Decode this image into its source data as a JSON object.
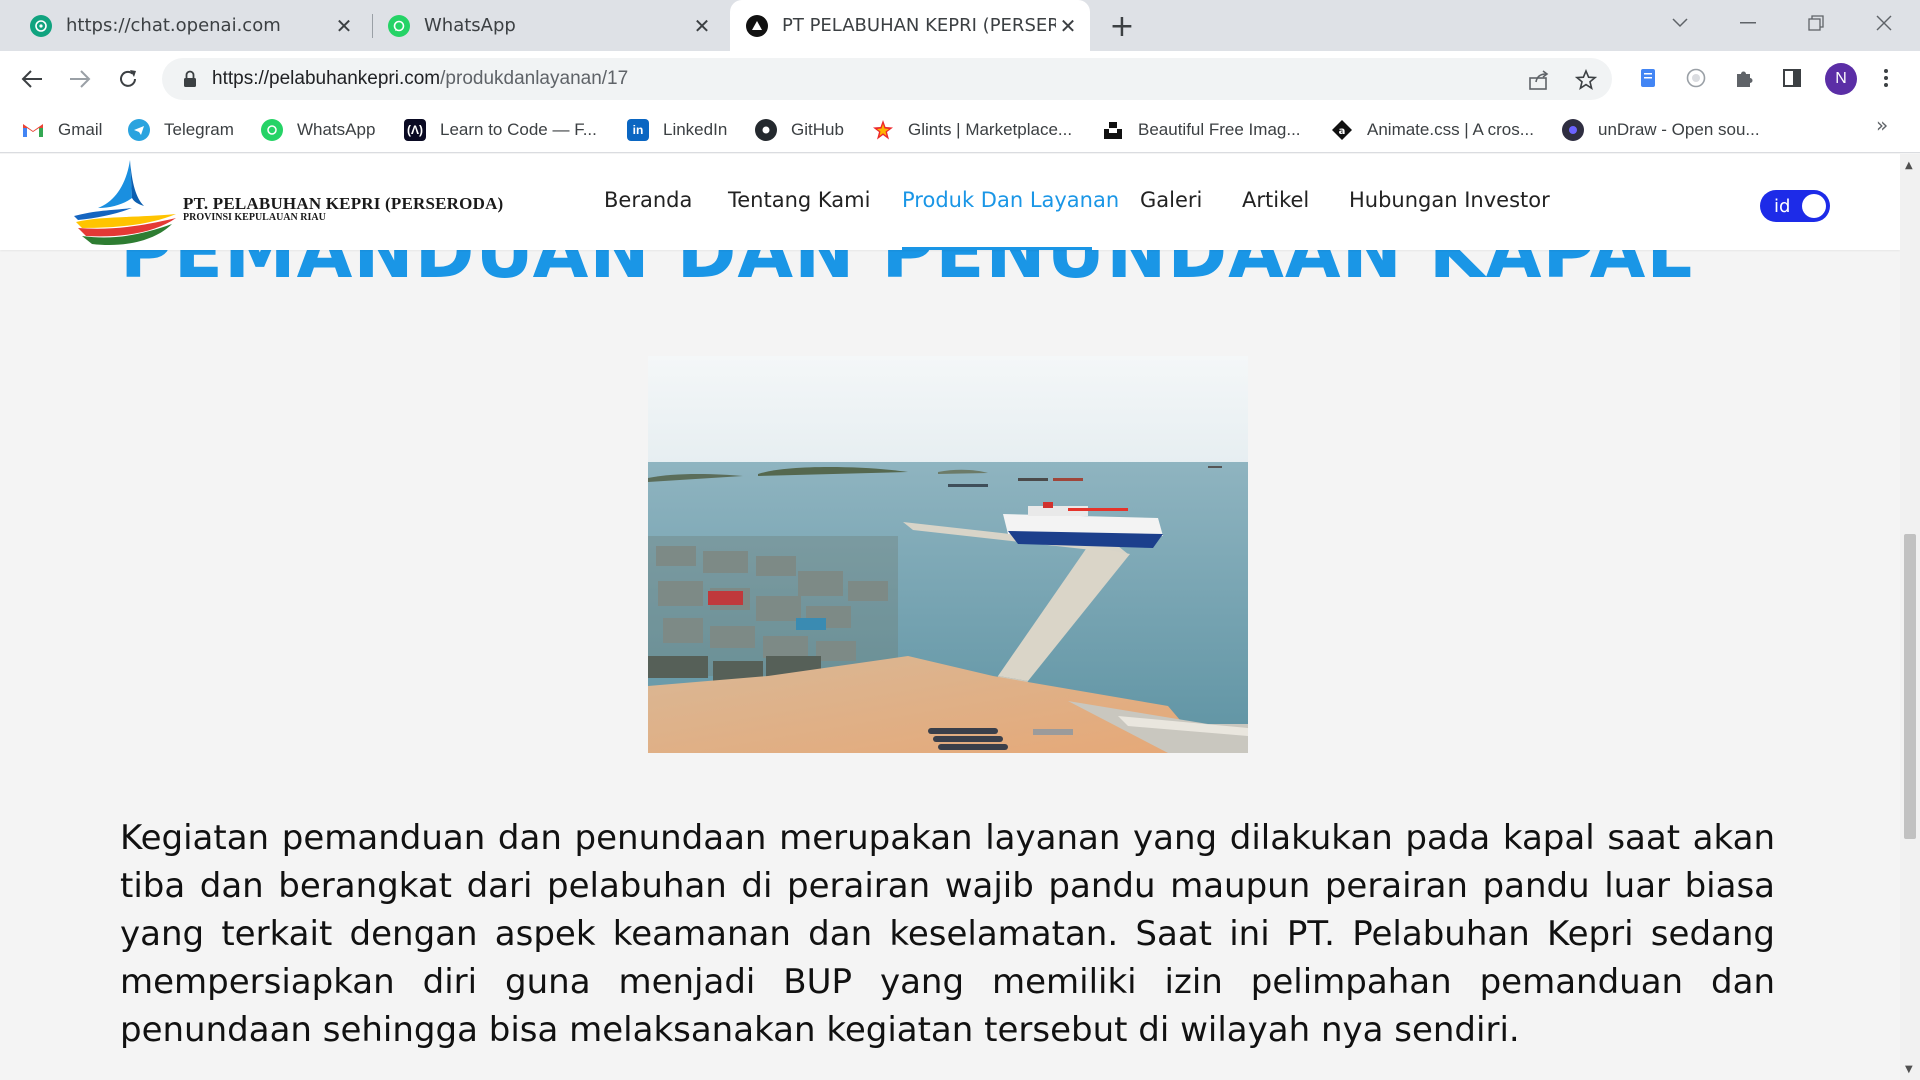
{
  "browser": {
    "tabs": [
      {
        "title": "https://chat.openai.com",
        "icon": "openai-icon",
        "active": false
      },
      {
        "title": "WhatsApp",
        "icon": "whatsapp-icon",
        "active": false
      },
      {
        "title": "PT PELABUHAN KEPRI (PERSERODA)",
        "icon": "site-favicon-icon",
        "active": true
      }
    ],
    "new_tab_symbol": "+",
    "url_domain": "https://pelabuhankepri.com",
    "url_path": "/produkdanlayanan/17",
    "profile_initial": "N",
    "bookmarks": [
      {
        "label": "Gmail",
        "icon": "gmail-icon",
        "color": "#ea4335"
      },
      {
        "label": "Telegram",
        "icon": "telegram-icon",
        "color": "#2aa3df"
      },
      {
        "label": "WhatsApp",
        "icon": "whatsapp-icon",
        "color": "#25d366"
      },
      {
        "label": "Learn to Code — F...",
        "icon": "freecodecamp-icon",
        "color": "#0a0a23"
      },
      {
        "label": "LinkedIn",
        "icon": "linkedin-icon",
        "color": "#0a66c2"
      },
      {
        "label": "GitHub",
        "icon": "github-icon",
        "color": "#24292e"
      },
      {
        "label": "Glints | Marketplace...",
        "icon": "glints-icon",
        "color": "#ec272b"
      },
      {
        "label": "Beautiful Free Imag...",
        "icon": "unsplash-icon",
        "color": "#111111"
      },
      {
        "label": "Animate.css | A cros...",
        "icon": "animate-icon",
        "color": "#111111"
      },
      {
        "label": "unDraw - Open sou...",
        "icon": "undraw-icon",
        "color": "#6c63ff"
      }
    ],
    "more_bookmarks": "»"
  },
  "site": {
    "brand_line1": "PT. PELABUHAN KEPRI (PERSERODA)",
    "brand_line2": "PROVINSI KEPULAUAN RIAU",
    "nav": [
      {
        "label": "Beranda",
        "active": false
      },
      {
        "label": "Tentang Kami",
        "active": false
      },
      {
        "label": "Produk Dan Layanan",
        "active": true
      },
      {
        "label": "Galeri",
        "active": false
      },
      {
        "label": "Artikel",
        "active": false
      },
      {
        "label": "Hubungan Investor",
        "active": false
      }
    ],
    "lang_label": "id",
    "accent_color": "#1a96e6"
  },
  "content": {
    "title": "PEMANDUAN DAN PENUNDAAN KAPAL",
    "description": "Kegiatan pemanduan dan penundaan merupakan layanan yang dilakukan pada kapal saat akan tiba dan berangkat dari pelabuhan di perairan wajib pandu maupun perairan pandu luar biasa yang terkait dengan aspek keamanan dan keselamatan. Saat ini PT. Pelabuhan Kepri sedang mempersiapkan diri guna menjadi BUP yang memiliki izin pelimpahan pemanduan dan penundaan sehingga bisa melaksanakan kegiatan tersebut di wilayah nya sendiri."
  }
}
